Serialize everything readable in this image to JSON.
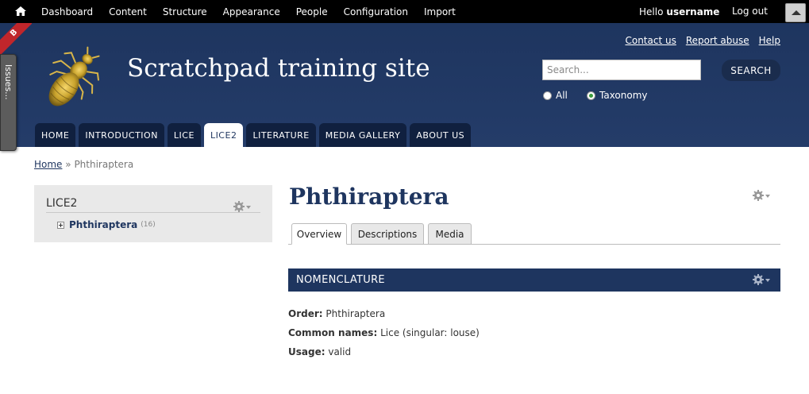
{
  "toolbar": {
    "home_icon": "home-icon",
    "menu": [
      "Dashboard",
      "Content",
      "Structure",
      "Appearance",
      "People",
      "Configuration",
      "Import"
    ],
    "greeting": "Hello",
    "username": "username",
    "logout": "Log out",
    "toggle_icon": "arrow-up-icon"
  },
  "corner_ribbon": "B",
  "issues_tab": "Issues...",
  "header": {
    "site_name": "Scratchpad training site",
    "logo_icon": "louse-logo",
    "secondary_links": [
      "Contact us",
      "Report abuse",
      "Help"
    ],
    "search": {
      "placeholder": "Search...",
      "button": "SEARCH",
      "options": [
        {
          "label": "All",
          "selected": false
        },
        {
          "label": "Taxonomy",
          "selected": true
        }
      ]
    },
    "tabs": [
      {
        "label": "HOME",
        "active": false
      },
      {
        "label": "INTRODUCTION",
        "active": false
      },
      {
        "label": "LICE",
        "active": false
      },
      {
        "label": "LICE2",
        "active": true
      },
      {
        "label": "LITERATURE",
        "active": false
      },
      {
        "label": "MEDIA GALLERY",
        "active": false
      },
      {
        "label": "ABOUT US",
        "active": false
      }
    ]
  },
  "breadcrumb": {
    "home": "Home",
    "separator": "»",
    "current": "Phthiraptera"
  },
  "sidebar": {
    "title": "LICE2",
    "gear_icon": "gear-icon",
    "tree": [
      {
        "label": "Phthiraptera",
        "count": "(16)"
      }
    ]
  },
  "main": {
    "title": "Phthiraptera",
    "gear_icon": "gear-icon",
    "tabs": [
      {
        "label": "Overview",
        "active": true
      },
      {
        "label": "Descriptions",
        "active": false
      },
      {
        "label": "Media",
        "active": false
      }
    ],
    "section_title": "NOMENCLATURE",
    "fields": [
      {
        "label": "Order:",
        "value": "Phthiraptera"
      },
      {
        "label": "Common names:",
        "value": "Lice (singular: louse)"
      },
      {
        "label": "Usage:",
        "value": "valid"
      }
    ]
  },
  "colors": {
    "toolbar": "#000000",
    "header": "#1e355f",
    "accent": "#1e355f",
    "block_bg": "#e9e9e9"
  }
}
